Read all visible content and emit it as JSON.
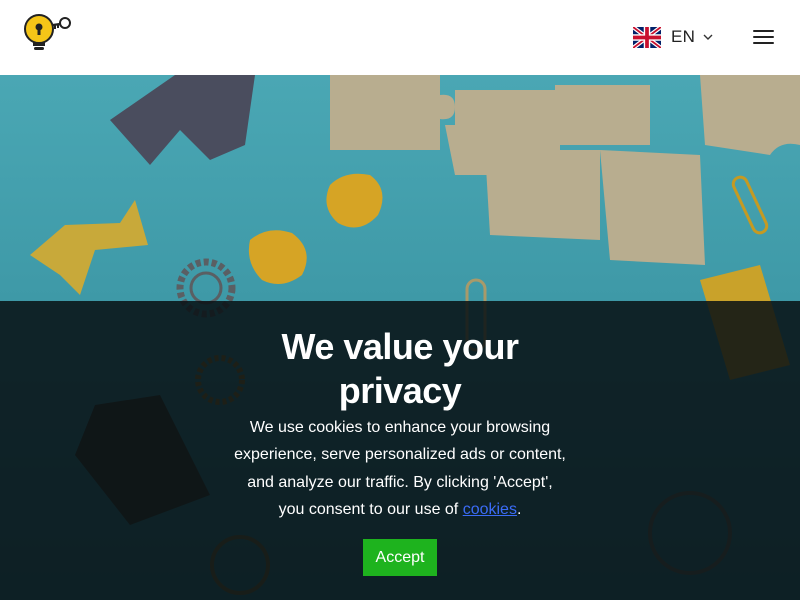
{
  "header": {
    "language_code": "EN",
    "logo_icon": "lightbulb-key-icon",
    "flag_icon": "uk-flag-icon",
    "menu_icon": "hamburger-menu-icon"
  },
  "cookie_banner": {
    "title_line1": "We value your",
    "title_line2": "privacy",
    "text_line1": "We use cookies to enhance your browsing",
    "text_line2": "experience, serve personalized ads or content,",
    "text_line3": "and analyze our traffic. By clicking 'Accept',",
    "text_line4_prefix": "you consent to our use of ",
    "link_text": "cookies",
    "text_line4_suffix": ".",
    "accept_label": "Accept"
  },
  "colors": {
    "accept_button": "#1eb31e",
    "link": "#3b6cf6",
    "logo_yellow": "#f5c518",
    "hero_background": "#4aa7b4"
  }
}
